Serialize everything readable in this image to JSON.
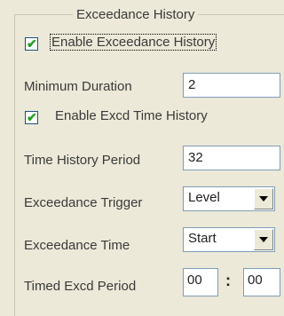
{
  "group": {
    "title": "Exceedance History"
  },
  "enable_exceedance_history": {
    "label": "Enable Exceedance History",
    "checked": true
  },
  "minimum_duration": {
    "label": "Minimum Duration",
    "value": "2"
  },
  "enable_excd_time_history": {
    "label": "Enable Excd Time History",
    "checked": true
  },
  "time_history_period": {
    "label": "Time History Period",
    "value": "32"
  },
  "exceedance_trigger": {
    "label": "Exceedance Trigger",
    "value": "Level"
  },
  "exceedance_time": {
    "label": "Exceedance Time",
    "value": "Start"
  },
  "timed_excd_period": {
    "label": "Timed Excd Period",
    "hours": "00",
    "separator": ":",
    "minutes": "00"
  },
  "colors": {
    "check": "#21a121",
    "field_border": "#7f9db9",
    "background": "#ece9d8"
  }
}
